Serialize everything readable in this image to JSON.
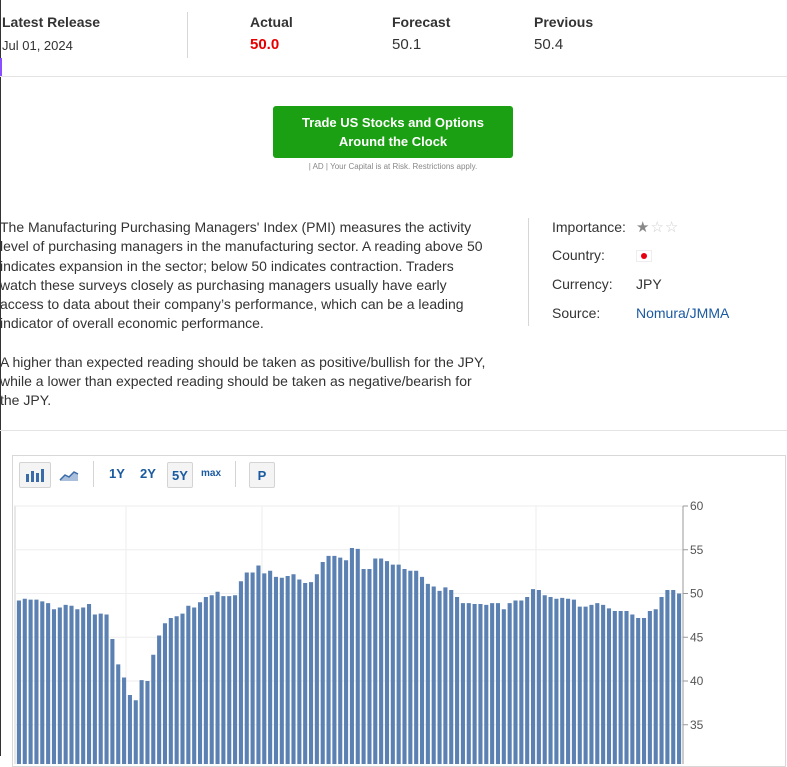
{
  "header": {
    "latest_release_label": "Latest Release",
    "latest_release_date": "Jul 01, 2024",
    "actual_label": "Actual",
    "actual_value": "50.0",
    "forecast_label": "Forecast",
    "forecast_value": "50.1",
    "previous_label": "Previous",
    "previous_value": "50.4"
  },
  "ad": {
    "button_line1": "Trade US Stocks and Options",
    "button_line2": "Around the Clock",
    "note": "| AD | Your Capital is at Risk. Restrictions apply."
  },
  "description": {
    "p1": "The Manufacturing Purchasing Managers' Index (PMI) measures the activity level of purchasing managers in the manufacturing sector. A reading above 50 indicates expansion in the sector; below 50 indicates contraction. Traders watch these surveys closely as purchasing managers usually have early access to data about their company’s performance, which can be a leading indicator of overall economic performance.",
    "p2": "A higher than expected reading should be taken as positive/bullish for the JPY, while a lower than expected reading should be taken as negative/bearish for the JPY."
  },
  "meta": {
    "importance_label": "Importance:",
    "importance_level": 1,
    "importance_max": 3,
    "country_label": "Country:",
    "country_flag": "japan-flag-icon",
    "currency_label": "Currency:",
    "currency_value": "JPY",
    "source_label": "Source:",
    "source_value": "Nomura/JMMA"
  },
  "toolbar": {
    "bar_chart_icon": "bar-chart-icon",
    "area_chart_icon": "area-chart-icon",
    "range_1y": "1Y",
    "range_2y": "2Y",
    "range_5y": "5Y",
    "range_max": "max",
    "p_button": "P",
    "selected_range": "5Y"
  },
  "chart_data": {
    "type": "bar",
    "y_ticks": [
      "60",
      "55",
      "50",
      "45",
      "40",
      "35"
    ],
    "ylim": [
      33,
      60
    ],
    "grid": true,
    "bar_color": "#5b80b2",
    "values": [
      49.2,
      49.4,
      49.3,
      49.3,
      49.1,
      48.9,
      48.2,
      48.4,
      48.7,
      48.6,
      48.2,
      48.4,
      48.8,
      47.6,
      47.7,
      47.6,
      44.8,
      41.9,
      40.4,
      38.4,
      37.8,
      40.1,
      40.0,
      43.0,
      45.2,
      46.6,
      47.2,
      47.4,
      47.7,
      48.6,
      48.4,
      49.0,
      49.6,
      49.8,
      50.2,
      49.7,
      49.7,
      49.8,
      51.4,
      52.4,
      52.4,
      53.2,
      52.3,
      52.6,
      51.9,
      51.8,
      52.0,
      52.2,
      51.6,
      51.2,
      51.3,
      52.2,
      53.6,
      54.3,
      54.3,
      54.1,
      53.8,
      55.2,
      55.1,
      52.8,
      52.8,
      54.0,
      54.0,
      53.7,
      53.3,
      53.3,
      52.8,
      52.6,
      52.6,
      51.9,
      51.1,
      50.8,
      50.3,
      50.7,
      50.4,
      49.6,
      48.9,
      48.9,
      48.8,
      48.8,
      48.7,
      48.9,
      48.9,
      48.2,
      48.9,
      49.2,
      49.2,
      49.6,
      50.5,
      50.4,
      49.8,
      49.6,
      49.4,
      49.5,
      49.4,
      49.3,
      48.5,
      48.5,
      48.7,
      48.9,
      48.7,
      48.3,
      48.0,
      48.0,
      48.0,
      47.6,
      47.2,
      47.2,
      48.0,
      48.2,
      49.6,
      50.4,
      50.4,
      50.0
    ]
  }
}
